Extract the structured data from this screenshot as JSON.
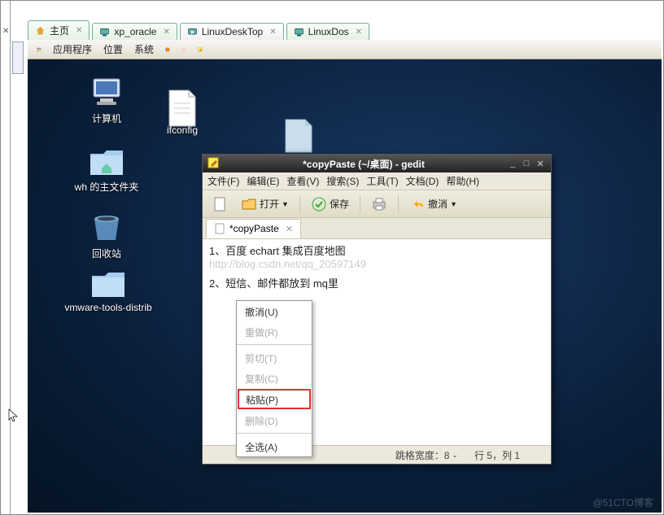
{
  "outerTabs": [
    {
      "label": "主页"
    },
    {
      "label": "xp_oracle"
    },
    {
      "label": "LinuxDeskTop",
      "active": true
    },
    {
      "label": "LinuxDos"
    }
  ],
  "panel": {
    "apps_label": "应用程序",
    "places_label": "位置",
    "system_label": "系统"
  },
  "desktopIcons": {
    "computer": "计算机",
    "ifconfig": "ifconfig",
    "wh_home": "wh 的主文件夹",
    "trash": "回收站",
    "vmware": "vmware-tools-distrib"
  },
  "gedit": {
    "title": "*copyPaste (~/桌面) - gedit",
    "menu": {
      "file": "文件(F)",
      "edit": "编辑(E)",
      "view": "查看(V)",
      "search": "搜索(S)",
      "tools": "工具(T)",
      "docs": "文档(D)",
      "help": "帮助(H)"
    },
    "toolbar": {
      "open": "打开",
      "save": "保存",
      "undo": "撤消"
    },
    "tab_label": "*copyPaste",
    "editor": {
      "line1": "1、百度 echart  集成百度地图",
      "watermark": "http://blog.csdn.net/qq_20597149",
      "line2": "2、短信、邮件都放到   mq里"
    },
    "context_menu": {
      "undo": "撤消(U)",
      "redo": "重做(R)",
      "cut": "剪切(T)",
      "copy": "复制(C)",
      "paste": "粘贴(P)",
      "delete": "删除(D)",
      "select_all": "全选(A)"
    },
    "status": {
      "tab_width": "跳格宽度：8",
      "pos": "行 5，列 1"
    }
  },
  "page_watermark": "@51CTO博客"
}
